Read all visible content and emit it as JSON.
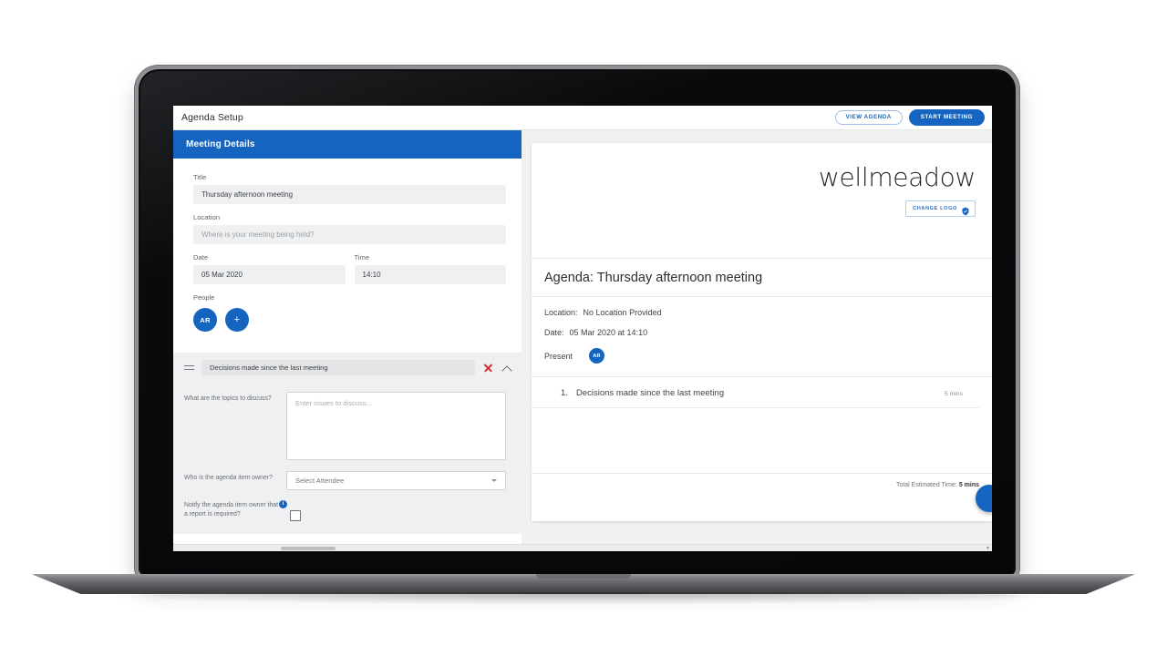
{
  "app": {
    "title": "Agenda Setup",
    "view_agenda_label": "VIEW AGENDA",
    "start_meeting_label": "START MEETING"
  },
  "left_panel": {
    "section_header": "Meeting Details",
    "fields": {
      "title_label": "Title",
      "title_value": "Thursday afternoon meeting",
      "location_label": "Location",
      "location_placeholder": "Where is your meeting being held?",
      "date_label": "Date",
      "date_value": "05 Mar 2020",
      "time_label": "Time",
      "time_value": "14:10",
      "people_label": "People"
    },
    "people": [
      {
        "initials": "AR"
      },
      {
        "initials": "+"
      }
    ],
    "item_editor": {
      "item_title": "Decisions made since the last meeting",
      "topics_label": "What are the topics to discuss?",
      "topics_placeholder": "Enter issues to discuss...",
      "owner_label": "Who is the agenda item owner?",
      "owner_value": "Select Attendee",
      "notify_label_line1": "Notify the agenda item owner that",
      "notify_label_line2": "a report is required?",
      "info_glyph": "i"
    }
  },
  "preview": {
    "brand": "wellmeadow",
    "change_logo_label": "CHANGE LOGO",
    "agenda_title": "Agenda: Thursday afternoon meeting",
    "location_key": "Location:",
    "location_value": "No Location Provided",
    "date_key": "Date:",
    "date_value": "05 Mar 2020 at 14:10",
    "present_key": "Present",
    "present_avatar": "AR",
    "items": [
      {
        "num": "1.",
        "text": "Decisions made since the last meeting",
        "duration": "5 mins"
      }
    ],
    "total_label": "Total Estimated Time:",
    "total_value": "5 mins"
  },
  "colors": {
    "accent": "#1565c0",
    "danger": "#d32f2f",
    "field_bg": "#eff0f1",
    "panel_bg": "#f1f1f1"
  }
}
